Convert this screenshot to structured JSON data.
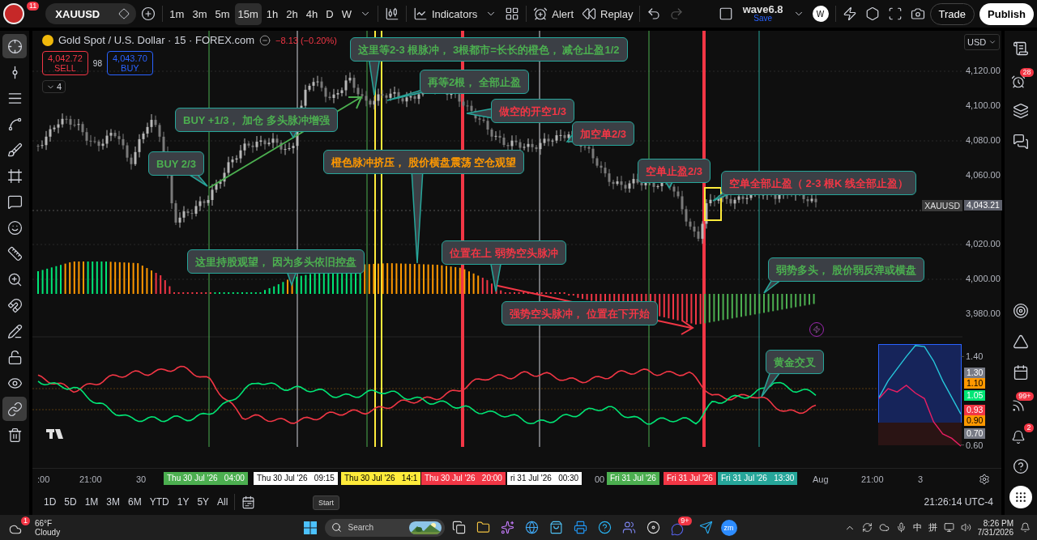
{
  "toolbar": {
    "avatar_badge": "11",
    "symbol": "XAUUSD",
    "intervals": [
      {
        "label": "1m",
        "selected": false
      },
      {
        "label": "3m",
        "selected": false
      },
      {
        "label": "5m",
        "selected": false
      },
      {
        "label": "15m",
        "selected": true
      },
      {
        "label": "1h",
        "selected": false
      },
      {
        "label": "2h",
        "selected": false
      },
      {
        "label": "4h",
        "selected": false
      },
      {
        "label": "D",
        "selected": false
      },
      {
        "label": "W",
        "selected": false
      }
    ],
    "indicators": "Indicators",
    "alert": "Alert",
    "replay": "Replay",
    "layout_name": "wave6.8",
    "save": "Save",
    "user_initial": "W",
    "trade": "Trade",
    "publish": "Publish"
  },
  "left_tools": [
    {
      "kind": "crosshair",
      "selected": true
    },
    {
      "kind": "trend-line",
      "selected": false
    },
    {
      "kind": "fib",
      "selected": false
    },
    {
      "kind": "pattern",
      "selected": false
    },
    {
      "kind": "brush",
      "selected": false
    },
    {
      "kind": "shape",
      "selected": false
    },
    {
      "kind": "text",
      "selected": false
    },
    {
      "kind": "emoji",
      "selected": false
    },
    {
      "kind": "measure",
      "selected": false
    },
    {
      "kind": "zoom",
      "selected": false
    },
    {
      "kind": "magnet",
      "selected": false
    },
    {
      "kind": "lock-drawing",
      "selected": false
    },
    {
      "kind": "lock",
      "selected": false
    },
    {
      "kind": "visibility",
      "selected": false
    },
    {
      "kind": "sync",
      "selected": true
    },
    {
      "kind": "remove",
      "selected": false
    }
  ],
  "legend": {
    "title": "Gold Spot / U.S. Dollar · 15 · FOREX.com",
    "change": "−8.13 (−0.20%)",
    "sell_price": "4,042.72",
    "sell_label": "SELL",
    "spread": "98",
    "buy_price": "4,043.70",
    "buy_label": "BUY",
    "collapsed_count": "4"
  },
  "callouts": [
    {
      "text": "这里等2-3 根脉冲， 3根都市=长长的橙色， 减仓止盈1/2",
      "color": "#4caf50"
    },
    {
      "text": "再等2根， 全部止盈",
      "color": "#4caf50"
    },
    {
      "text": "BUY +1/3， 加仓 多头脉冲增强",
      "color": "#4caf50"
    },
    {
      "text": "做空的开空1/3",
      "color": "#f23645"
    },
    {
      "text": "加空单2/3",
      "color": "#f23645"
    },
    {
      "text": "BUY 2/3",
      "color": "#4caf50"
    },
    {
      "text": "橙色脉冲挤压， 股价横盘震荡 空仓观望",
      "color": "#ff9800"
    },
    {
      "text": "空单止盈2/3",
      "color": "#f23645"
    },
    {
      "text": "空单全部止盈（  2-3 根K 线全部止盈）",
      "color": "#f23645"
    },
    {
      "text": "位置在上 弱势空头脉冲",
      "color": "#f23645"
    },
    {
      "text": "这里持股观望， 因为多头依旧控盘",
      "color": "#4caf50"
    },
    {
      "text": "弱势多头， 股价弱反弹或横盘",
      "color": "#4caf50"
    },
    {
      "text": "强势空头脉冲， 位置在下开始",
      "color": "#f23645"
    },
    {
      "text": "黄金交叉",
      "color": "#4caf50"
    }
  ],
  "mini_chart": {
    "chart_data": {
      "type": "line",
      "ylim": [
        0.59,
        1.52
      ],
      "yticks": [
        {
          "value": 0.6,
          "label": "0.60"
        },
        {
          "value": 1.4,
          "label": "1.40"
        }
      ],
      "series": [
        {
          "color": "#26c6da",
          "values": [
            1.03,
            1.18,
            1.29,
            1.4,
            1.5,
            1.49,
            1.36,
            1.18,
            1.03,
            0.88
          ]
        },
        {
          "color": "#e91e63",
          "values": [
            1.02,
            1.11,
            1.08,
            1.14,
            1.07,
            1.02,
            0.81,
            0.7,
            0.66,
            0.59
          ]
        }
      ]
    }
  },
  "currency": "USD",
  "price_axis": [
    "4,120.00",
    "4,100.00",
    "4,080.00",
    "4,060.00",
    "4,020.00",
    "4,000.00",
    "3,980.00"
  ],
  "last_price": {
    "symbol": "XAUUSD",
    "price": "4,043.21"
  },
  "oscillator_axis": [
    {
      "label": "1.30",
      "color": "#787b86"
    },
    {
      "label": "1.10",
      "color": "#ff9800"
    },
    {
      "label": "1.05",
      "color": "#00e676"
    },
    {
      "label": "0.93",
      "color": "#f23645"
    },
    {
      "label": "0.90",
      "color": "#ff9800"
    },
    {
      "label": "0.70",
      "color": "#787b86"
    }
  ],
  "time_axis": [
    {
      "kind": "tick",
      "label": ":00"
    },
    {
      "kind": "tick",
      "label": "21:00"
    },
    {
      "kind": "tick",
      "label": "30"
    },
    {
      "kind": "marker",
      "label": "Thu 30 Jul '26   04:00",
      "color": "#4caf50"
    },
    {
      "kind": "marker",
      "label": "Thu 30 Jul '26   09:15",
      "color": "#ffffff"
    },
    {
      "kind": "marker",
      "label": "Thu 30 Jul '26   14:1",
      "color": "#ffeb3b"
    },
    {
      "kind": "marker",
      "label": "Thu 30 Jul '26   20:00",
      "color": "#f23645"
    },
    {
      "kind": "marker",
      "label": "ri 31 Jul '26   00:30",
      "color": "#ffffff"
    },
    {
      "kind": "tick",
      "label": "00"
    },
    {
      "kind": "marker",
      "label": "Fri 31 Jul '26",
      "color": "#4caf50"
    },
    {
      "kind": "marker",
      "label": "Fri 31 Jul '26",
      "color": "#f23645"
    },
    {
      "kind": "marker",
      "label": "Fri 31 Jul '26   13:30",
      "color": "#26a69a"
    },
    {
      "kind": "tick",
      "label": "Aug"
    },
    {
      "kind": "tick",
      "label": "21:00"
    },
    {
      "kind": "tick",
      "label": "3"
    }
  ],
  "ranges": [
    "1D",
    "5D",
    "1M",
    "3M",
    "6M",
    "YTD",
    "1Y",
    "5Y",
    "All"
  ],
  "clock": "21:26:14 UTC-4",
  "tooltip": "Start",
  "right_sidebar": {
    "top": [
      {
        "kind": "watchlist"
      },
      {
        "kind": "alerts",
        "badge": "28"
      },
      {
        "kind": "layers"
      },
      {
        "kind": "chat"
      }
    ],
    "bottom": [
      {
        "kind": "target"
      },
      {
        "kind": "triangle"
      },
      {
        "kind": "calendar"
      },
      {
        "kind": "feed",
        "badge": "99+"
      },
      {
        "kind": "notifications",
        "badge": "2"
      },
      {
        "kind": "help"
      },
      {
        "kind": "apps"
      }
    ]
  },
  "taskbar": {
    "weather_badge": "1",
    "temperature": "66°F",
    "condition": "Cloudy",
    "search": {
      "placeholder": "Search"
    },
    "apps": [
      {
        "kind": "task-view"
      },
      {
        "kind": "folder"
      },
      {
        "kind": "copilot"
      },
      {
        "kind": "browser"
      },
      {
        "kind": "store"
      },
      {
        "kind": "printer"
      },
      {
        "kind": "help"
      },
      {
        "kind": "people"
      },
      {
        "kind": "disc"
      },
      {
        "kind": "chat",
        "badge": "9+"
      },
      {
        "kind": "plane"
      },
      {
        "kind": "text-app",
        "label": "zm"
      }
    ],
    "ime": [
      "中",
      "拼"
    ],
    "time": "8:26 PM",
    "date": "7/31/2026"
  }
}
